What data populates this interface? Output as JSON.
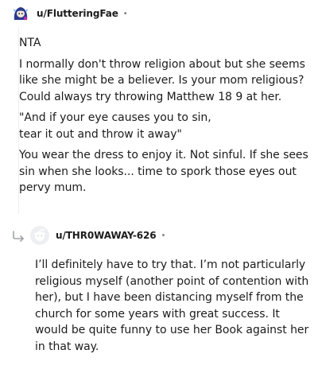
{
  "comment": {
    "username": "u/FlutteringFae",
    "separator": "•",
    "paragraphs": [
      "NTA",
      "I normally don't throw religion about but she seems like she might be a believer. Is your mom religious? Could always try throwing Matthew 18 9 at her.",
      "\"And if your eye causes you to sin,",
      "tear it out and throw it away\"",
      "You wear the dress to enjoy it. Not sinful. If she sees sin when she looks... time to spork those eyes out pervy mum."
    ]
  },
  "reply": {
    "username": "u/THR0WAWAY-626",
    "separator": "•",
    "paragraphs": [
      "I’ll definitely have to try that. I’m not particularly religious myself (another point of contention with her), but I have been distancing myself from the church for some years with great success. It would be quite funny to use her Book against her in that way."
    ]
  },
  "colors": {
    "text": "#1c1c1c",
    "meta": "#7c7c7c",
    "avatar_bg_top": "#0079d3",
    "avatar_bg_reply": "#edeff1"
  }
}
